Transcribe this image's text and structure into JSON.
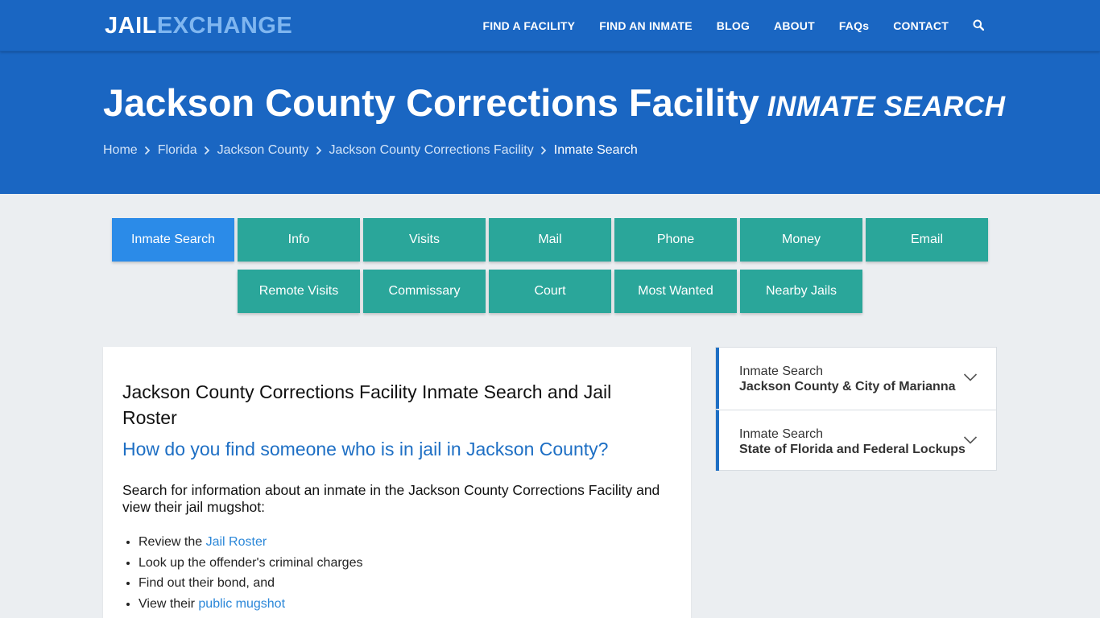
{
  "logo": {
    "part1": "JAIL",
    "part2": "EXCHANGE"
  },
  "nav": {
    "items": [
      "FIND A FACILITY",
      "FIND AN INMATE",
      "BLOG",
      "ABOUT",
      "FAQs",
      "CONTACT"
    ],
    "search_icon": "search-icon"
  },
  "hero": {
    "title": "Jackson County Corrections Facility",
    "subtitle": "INMATE SEARCH",
    "breadcrumb": [
      "Home",
      "Florida",
      "Jackson County",
      "Jackson County Corrections Facility",
      "Inmate Search"
    ]
  },
  "tabs": {
    "row1": [
      "Inmate Search",
      "Info",
      "Visits",
      "Mail",
      "Phone",
      "Money",
      "Email"
    ],
    "row2": [
      "Remote Visits",
      "Commissary",
      "Court",
      "Most Wanted",
      "Nearby Jails"
    ],
    "active": "Inmate Search"
  },
  "content": {
    "heading": "Jackson County Corrections Facility Inmate Search and Jail Roster",
    "question": "How do you find someone who is in jail in Jackson County?",
    "lead": "Search for information about an inmate in the Jackson County Corrections Facility and view their jail mugshot:",
    "list": [
      {
        "text": "Review the ",
        "link": "Jail Roster"
      },
      {
        "text": "Look up the offender's criminal charges",
        "link": ""
      },
      {
        "text": "Find out their bond, and",
        "link": ""
      },
      {
        "text": "View their ",
        "link": "public mugshot"
      }
    ]
  },
  "sidebar": {
    "items": [
      {
        "label": "Inmate Search",
        "sub": "Jackson County & City of Marianna"
      },
      {
        "label": "Inmate Search",
        "sub": "State of Florida and Federal Lockups"
      }
    ]
  },
  "colors": {
    "header_blue": "#1a66c2",
    "tab_teal": "#2aa69a",
    "tab_active": "#2b8be8",
    "link_blue": "#2b87d8",
    "question_blue": "#1e6fc4"
  }
}
